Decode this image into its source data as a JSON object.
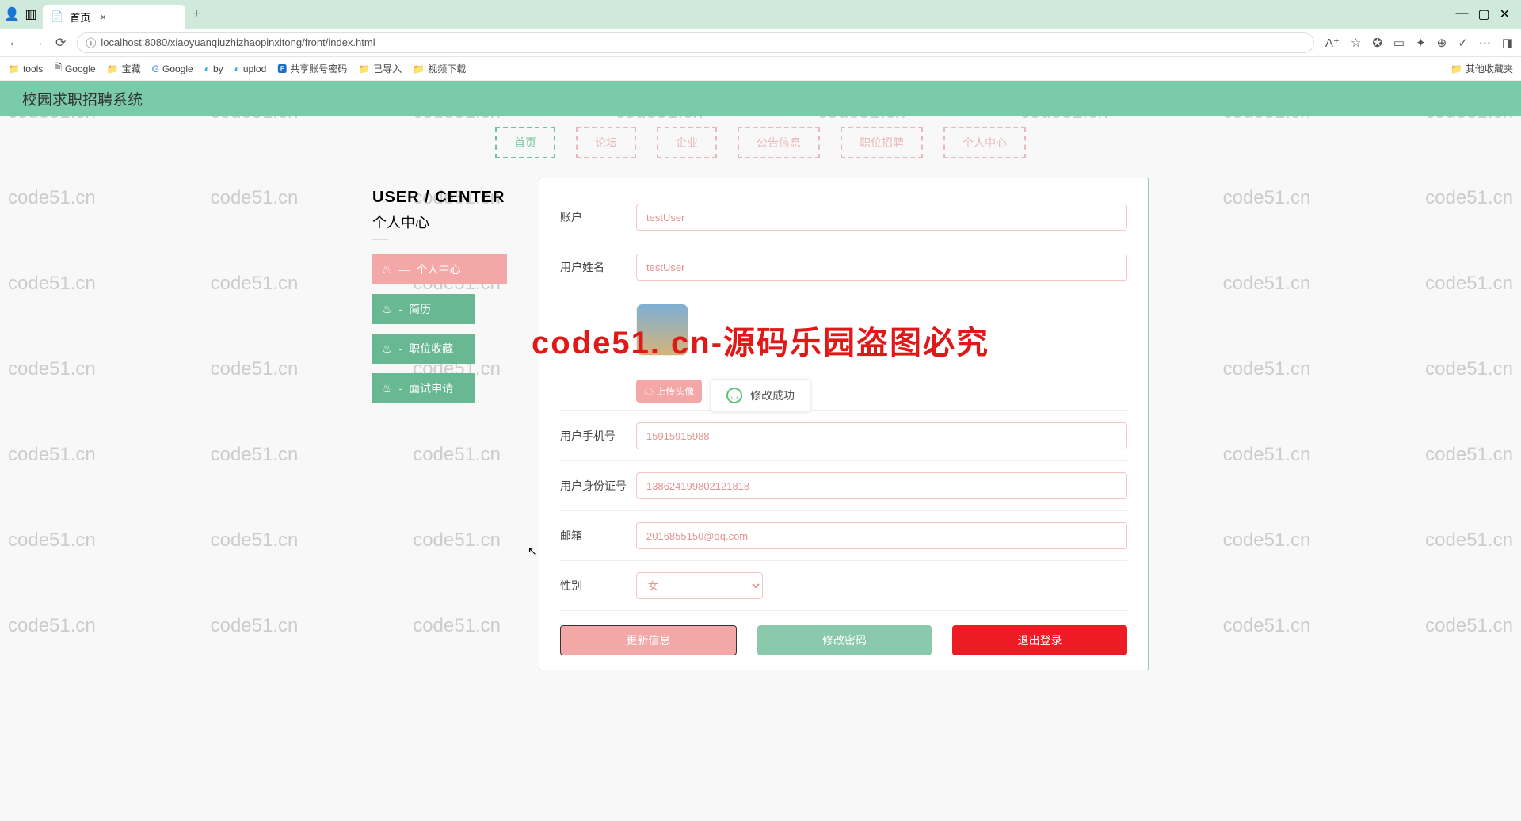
{
  "browser": {
    "tab_title": "首页",
    "url": "localhost:8080/xiaoyuanqiuzhizhaopinxitong/front/index.html",
    "bookmarks": [
      "tools",
      "Google",
      "宝藏",
      "Google",
      "by",
      "uplod",
      "共享账号密码",
      "已导入",
      "视频下载"
    ],
    "bookmark_right": "其他收藏夹"
  },
  "header": {
    "title": "校园求职招聘系统"
  },
  "nav": [
    "首页",
    "论坛",
    "企业",
    "公告信息",
    "职位招聘",
    "个人中心"
  ],
  "sidebar": {
    "title": "USER / CENTER",
    "subtitle": "个人中心",
    "items": [
      {
        "label": "个人中心",
        "active": true,
        "dashed": true
      },
      {
        "label": "简历"
      },
      {
        "label": "职位收藏"
      },
      {
        "label": "面试申请"
      }
    ]
  },
  "form": {
    "account_label": "账户",
    "account_value": "testUser",
    "name_label": "用户姓名",
    "name_value": "testUser",
    "upload_label": "☁ 上传头像",
    "phone_label": "用户手机号",
    "phone_value": "15915915988",
    "id_label": "用户身份证号",
    "id_value": "138624199802121818",
    "email_label": "邮箱",
    "email_value": "2016855150@qq.com",
    "gender_label": "性别",
    "gender_value": "女"
  },
  "buttons": {
    "update": "更新信息",
    "password": "修改密码",
    "logout": "退出登录"
  },
  "toast": {
    "text": "修改成功"
  },
  "watermark": {
    "text": "code51.cn",
    "big": "code51. cn-源码乐园盗图必究"
  }
}
